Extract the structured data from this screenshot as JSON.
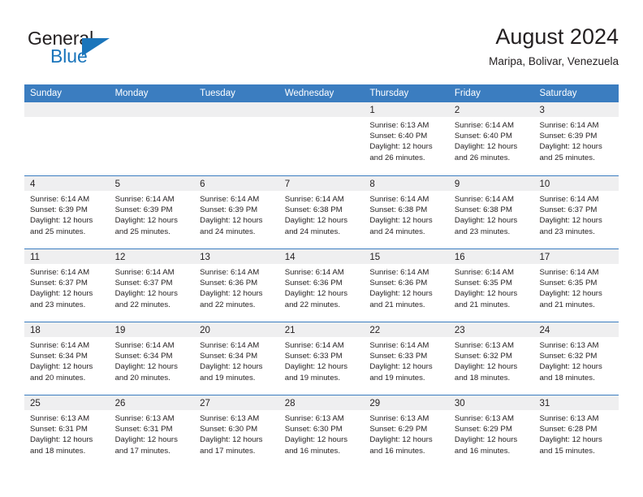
{
  "brand": {
    "line1": "General",
    "line2": "Blue",
    "triangle_color": "#1b75bb",
    "text_color": "#231f20"
  },
  "header": {
    "title": "August 2024",
    "location": "Maripa, Bolivar, Venezuela"
  },
  "theme": {
    "header_blue": "#3b7dc0",
    "daynum_band": "#efeff0",
    "text": "#231f20",
    "header_text": "#ffffff"
  },
  "weekdays": [
    "Sunday",
    "Monday",
    "Tuesday",
    "Wednesday",
    "Thursday",
    "Friday",
    "Saturday"
  ],
  "weeks": [
    [
      {
        "day": "",
        "sunrise": "",
        "sunset": "",
        "daylight1": "",
        "daylight2": ""
      },
      {
        "day": "",
        "sunrise": "",
        "sunset": "",
        "daylight1": "",
        "daylight2": ""
      },
      {
        "day": "",
        "sunrise": "",
        "sunset": "",
        "daylight1": "",
        "daylight2": ""
      },
      {
        "day": "",
        "sunrise": "",
        "sunset": "",
        "daylight1": "",
        "daylight2": ""
      },
      {
        "day": "1",
        "sunrise": "Sunrise: 6:13 AM",
        "sunset": "Sunset: 6:40 PM",
        "daylight1": "Daylight: 12 hours",
        "daylight2": "and 26 minutes."
      },
      {
        "day": "2",
        "sunrise": "Sunrise: 6:14 AM",
        "sunset": "Sunset: 6:40 PM",
        "daylight1": "Daylight: 12 hours",
        "daylight2": "and 26 minutes."
      },
      {
        "day": "3",
        "sunrise": "Sunrise: 6:14 AM",
        "sunset": "Sunset: 6:39 PM",
        "daylight1": "Daylight: 12 hours",
        "daylight2": "and 25 minutes."
      }
    ],
    [
      {
        "day": "4",
        "sunrise": "Sunrise: 6:14 AM",
        "sunset": "Sunset: 6:39 PM",
        "daylight1": "Daylight: 12 hours",
        "daylight2": "and 25 minutes."
      },
      {
        "day": "5",
        "sunrise": "Sunrise: 6:14 AM",
        "sunset": "Sunset: 6:39 PM",
        "daylight1": "Daylight: 12 hours",
        "daylight2": "and 25 minutes."
      },
      {
        "day": "6",
        "sunrise": "Sunrise: 6:14 AM",
        "sunset": "Sunset: 6:39 PM",
        "daylight1": "Daylight: 12 hours",
        "daylight2": "and 24 minutes."
      },
      {
        "day": "7",
        "sunrise": "Sunrise: 6:14 AM",
        "sunset": "Sunset: 6:38 PM",
        "daylight1": "Daylight: 12 hours",
        "daylight2": "and 24 minutes."
      },
      {
        "day": "8",
        "sunrise": "Sunrise: 6:14 AM",
        "sunset": "Sunset: 6:38 PM",
        "daylight1": "Daylight: 12 hours",
        "daylight2": "and 24 minutes."
      },
      {
        "day": "9",
        "sunrise": "Sunrise: 6:14 AM",
        "sunset": "Sunset: 6:38 PM",
        "daylight1": "Daylight: 12 hours",
        "daylight2": "and 23 minutes."
      },
      {
        "day": "10",
        "sunrise": "Sunrise: 6:14 AM",
        "sunset": "Sunset: 6:37 PM",
        "daylight1": "Daylight: 12 hours",
        "daylight2": "and 23 minutes."
      }
    ],
    [
      {
        "day": "11",
        "sunrise": "Sunrise: 6:14 AM",
        "sunset": "Sunset: 6:37 PM",
        "daylight1": "Daylight: 12 hours",
        "daylight2": "and 23 minutes."
      },
      {
        "day": "12",
        "sunrise": "Sunrise: 6:14 AM",
        "sunset": "Sunset: 6:37 PM",
        "daylight1": "Daylight: 12 hours",
        "daylight2": "and 22 minutes."
      },
      {
        "day": "13",
        "sunrise": "Sunrise: 6:14 AM",
        "sunset": "Sunset: 6:36 PM",
        "daylight1": "Daylight: 12 hours",
        "daylight2": "and 22 minutes."
      },
      {
        "day": "14",
        "sunrise": "Sunrise: 6:14 AM",
        "sunset": "Sunset: 6:36 PM",
        "daylight1": "Daylight: 12 hours",
        "daylight2": "and 22 minutes."
      },
      {
        "day": "15",
        "sunrise": "Sunrise: 6:14 AM",
        "sunset": "Sunset: 6:36 PM",
        "daylight1": "Daylight: 12 hours",
        "daylight2": "and 21 minutes."
      },
      {
        "day": "16",
        "sunrise": "Sunrise: 6:14 AM",
        "sunset": "Sunset: 6:35 PM",
        "daylight1": "Daylight: 12 hours",
        "daylight2": "and 21 minutes."
      },
      {
        "day": "17",
        "sunrise": "Sunrise: 6:14 AM",
        "sunset": "Sunset: 6:35 PM",
        "daylight1": "Daylight: 12 hours",
        "daylight2": "and 21 minutes."
      }
    ],
    [
      {
        "day": "18",
        "sunrise": "Sunrise: 6:14 AM",
        "sunset": "Sunset: 6:34 PM",
        "daylight1": "Daylight: 12 hours",
        "daylight2": "and 20 minutes."
      },
      {
        "day": "19",
        "sunrise": "Sunrise: 6:14 AM",
        "sunset": "Sunset: 6:34 PM",
        "daylight1": "Daylight: 12 hours",
        "daylight2": "and 20 minutes."
      },
      {
        "day": "20",
        "sunrise": "Sunrise: 6:14 AM",
        "sunset": "Sunset: 6:34 PM",
        "daylight1": "Daylight: 12 hours",
        "daylight2": "and 19 minutes."
      },
      {
        "day": "21",
        "sunrise": "Sunrise: 6:14 AM",
        "sunset": "Sunset: 6:33 PM",
        "daylight1": "Daylight: 12 hours",
        "daylight2": "and 19 minutes."
      },
      {
        "day": "22",
        "sunrise": "Sunrise: 6:14 AM",
        "sunset": "Sunset: 6:33 PM",
        "daylight1": "Daylight: 12 hours",
        "daylight2": "and 19 minutes."
      },
      {
        "day": "23",
        "sunrise": "Sunrise: 6:13 AM",
        "sunset": "Sunset: 6:32 PM",
        "daylight1": "Daylight: 12 hours",
        "daylight2": "and 18 minutes."
      },
      {
        "day": "24",
        "sunrise": "Sunrise: 6:13 AM",
        "sunset": "Sunset: 6:32 PM",
        "daylight1": "Daylight: 12 hours",
        "daylight2": "and 18 minutes."
      }
    ],
    [
      {
        "day": "25",
        "sunrise": "Sunrise: 6:13 AM",
        "sunset": "Sunset: 6:31 PM",
        "daylight1": "Daylight: 12 hours",
        "daylight2": "and 18 minutes."
      },
      {
        "day": "26",
        "sunrise": "Sunrise: 6:13 AM",
        "sunset": "Sunset: 6:31 PM",
        "daylight1": "Daylight: 12 hours",
        "daylight2": "and 17 minutes."
      },
      {
        "day": "27",
        "sunrise": "Sunrise: 6:13 AM",
        "sunset": "Sunset: 6:30 PM",
        "daylight1": "Daylight: 12 hours",
        "daylight2": "and 17 minutes."
      },
      {
        "day": "28",
        "sunrise": "Sunrise: 6:13 AM",
        "sunset": "Sunset: 6:30 PM",
        "daylight1": "Daylight: 12 hours",
        "daylight2": "and 16 minutes."
      },
      {
        "day": "29",
        "sunrise": "Sunrise: 6:13 AM",
        "sunset": "Sunset: 6:29 PM",
        "daylight1": "Daylight: 12 hours",
        "daylight2": "and 16 minutes."
      },
      {
        "day": "30",
        "sunrise": "Sunrise: 6:13 AM",
        "sunset": "Sunset: 6:29 PM",
        "daylight1": "Daylight: 12 hours",
        "daylight2": "and 16 minutes."
      },
      {
        "day": "31",
        "sunrise": "Sunrise: 6:13 AM",
        "sunset": "Sunset: 6:28 PM",
        "daylight1": "Daylight: 12 hours",
        "daylight2": "and 15 minutes."
      }
    ]
  ]
}
